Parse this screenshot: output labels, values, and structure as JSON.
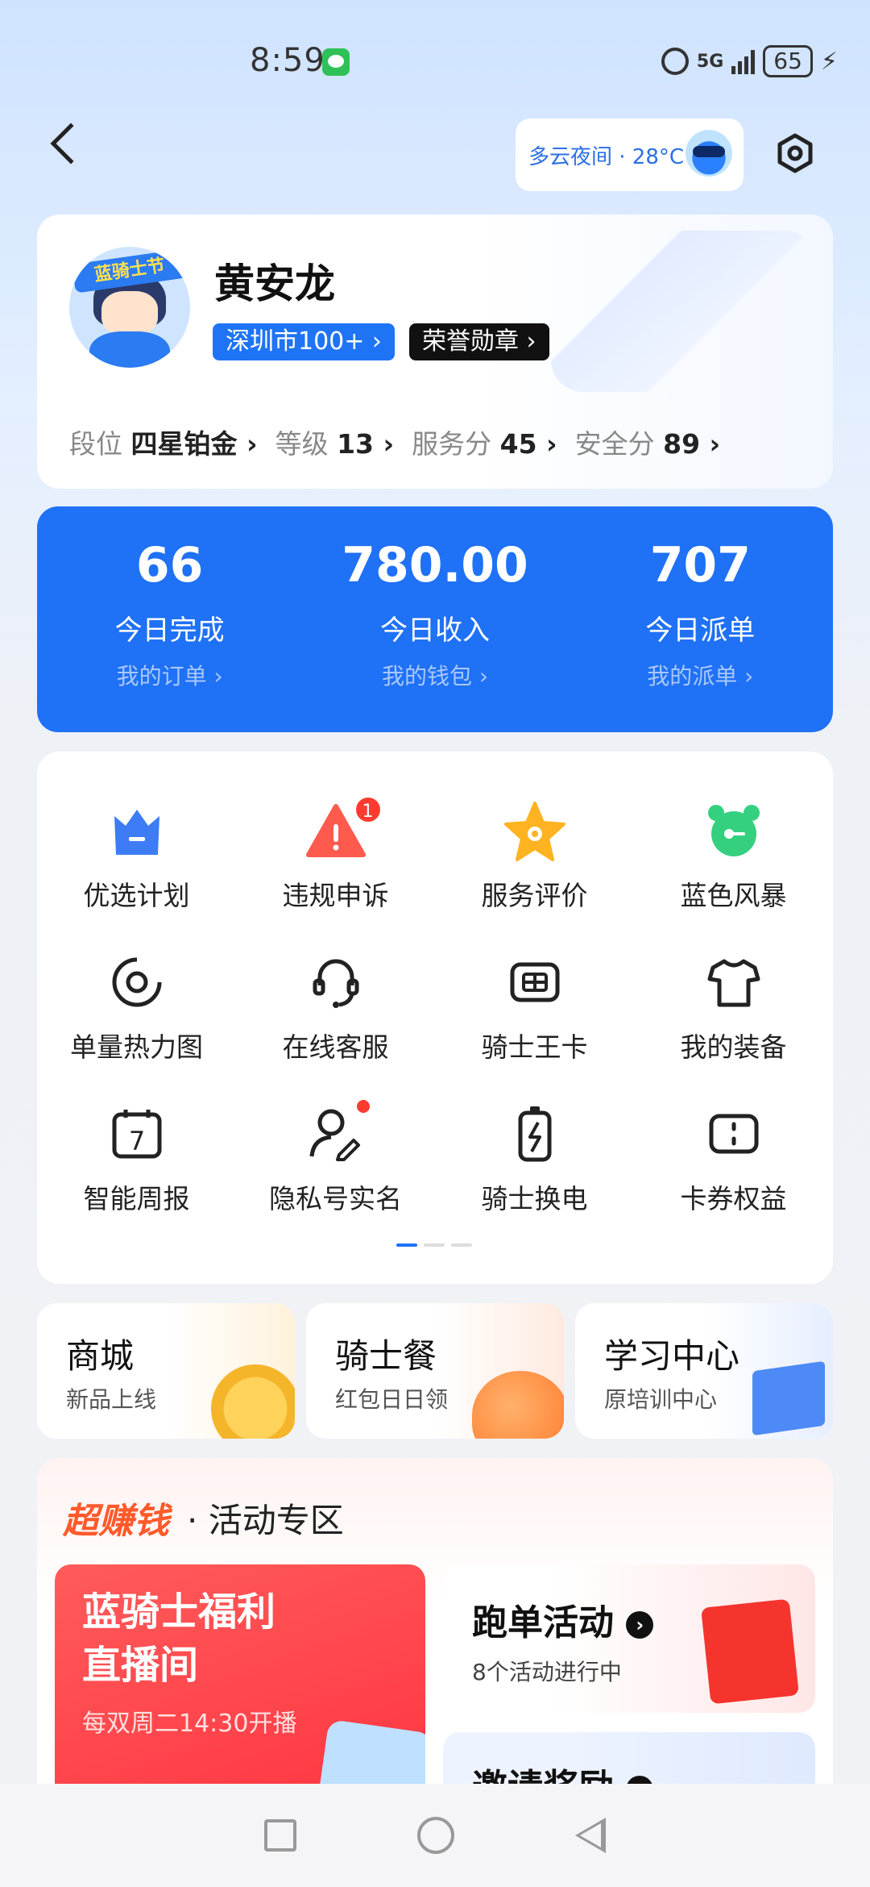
{
  "status_bar": {
    "time": "8:59",
    "network": "5G",
    "battery": "65"
  },
  "header": {
    "weather": "多云夜间 · 28°C"
  },
  "profile": {
    "name": "黄安龙",
    "avatar_tag": "蓝骑士节",
    "city_badge": "深圳市100+ ›",
    "honor_badge": "荣誉勋章 ›",
    "stats": [
      {
        "label": "段位",
        "value": "四星铂金 ›"
      },
      {
        "label": "等级",
        "value": "13 ›"
      },
      {
        "label": "服务分",
        "value": "45 ›"
      },
      {
        "label": "安全分",
        "value": "89 ›"
      }
    ]
  },
  "summary": [
    {
      "value": "66",
      "label": "今日完成",
      "link": "我的订单 ›"
    },
    {
      "value": "780.00",
      "label": "今日收入",
      "link": "我的钱包 ›"
    },
    {
      "value": "707",
      "label": "今日派单",
      "link": "我的派单 ›"
    }
  ],
  "grid": [
    {
      "label": "优选计划",
      "icon": "crown-icon",
      "color": "#3d7cf5"
    },
    {
      "label": "违规申诉",
      "icon": "warning-icon",
      "color": "#ff5a4e",
      "badge": "1"
    },
    {
      "label": "服务评价",
      "icon": "star-icon",
      "color": "#ffb320"
    },
    {
      "label": "蓝色风暴",
      "icon": "alarm-clock-icon",
      "color": "#35d07f"
    },
    {
      "label": "单量热力图",
      "icon": "target-icon"
    },
    {
      "label": "在线客服",
      "icon": "headset-icon"
    },
    {
      "label": "骑士王卡",
      "icon": "sim-card-icon"
    },
    {
      "label": "我的装备",
      "icon": "tshirt-icon"
    },
    {
      "label": "智能周报",
      "icon": "calendar-icon",
      "day": "7"
    },
    {
      "label": "隐私号实名",
      "icon": "user-edit-icon",
      "dot": true
    },
    {
      "label": "骑士换电",
      "icon": "battery-swap-icon"
    },
    {
      "label": "卡券权益",
      "icon": "coupon-icon"
    }
  ],
  "tiles": [
    {
      "title": "商城",
      "sub": "新品上线"
    },
    {
      "title": "骑士餐",
      "sub": "红包日日领"
    },
    {
      "title": "学习中心",
      "sub": "原培训中心"
    }
  ],
  "activity": {
    "hot": "超赚钱",
    "title": "· 活动专区",
    "live_line1": "蓝骑士福利",
    "live_line2": "直播间",
    "live_time": "每双周二14:30开播",
    "run_title": "跑单活动",
    "run_sub": "8个活动进行中",
    "invite_title": "邀请奖励"
  },
  "colors": {
    "primary": "#1f71f5",
    "hot": "#ff5a2b"
  }
}
